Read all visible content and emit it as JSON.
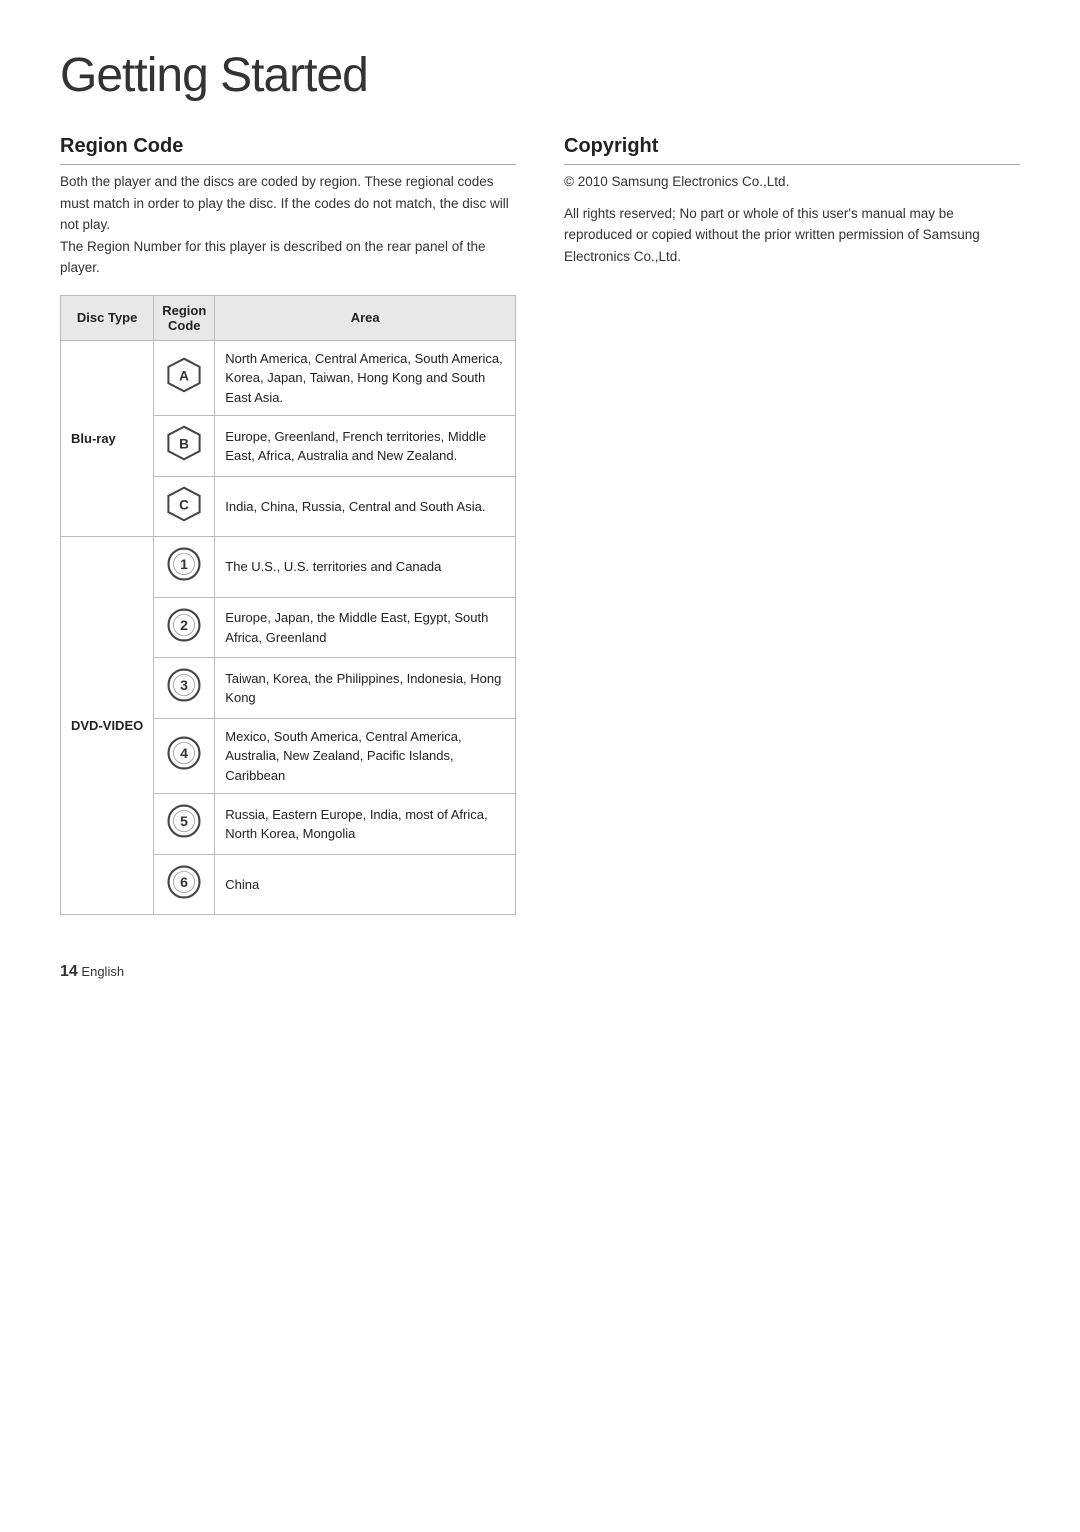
{
  "page": {
    "title": "Getting Started",
    "footer_page_number": "14",
    "footer_language": "English"
  },
  "region_code": {
    "section_title": "Region Code",
    "intro_paragraphs": [
      "Both the player and the discs are coded by region. These regional codes must match in order to play the disc. If the codes do not match, the disc will not play.",
      "The Region Number for this player is described on the rear panel of the player."
    ],
    "table_headers": [
      "Disc Type",
      "Region Code",
      "Area"
    ],
    "rows": [
      {
        "disc_type": "Blu-ray",
        "region_symbol": "A",
        "region_type": "hexagon",
        "area": "North America, Central America, South America, Korea, Japan, Taiwan, Hong Kong and South East Asia.",
        "rowspan": 3,
        "first_in_group": true
      },
      {
        "disc_type": "",
        "region_symbol": "B",
        "region_type": "hexagon",
        "area": "Europe, Greenland, French territories, Middle East, Africa, Australia and New Zealand.",
        "first_in_group": false
      },
      {
        "disc_type": "",
        "region_symbol": "C",
        "region_type": "hexagon",
        "area": "India, China, Russia, Central and South Asia.",
        "first_in_group": false
      },
      {
        "disc_type": "DVD-VIDEO",
        "region_symbol": "1",
        "region_type": "circle",
        "area": "The U.S., U.S. territories and Canada",
        "rowspan": 6,
        "first_in_group": true
      },
      {
        "disc_type": "",
        "region_symbol": "2",
        "region_type": "circle",
        "area": "Europe, Japan, the Middle East, Egypt, South Africa, Greenland",
        "first_in_group": false
      },
      {
        "disc_type": "",
        "region_symbol": "3",
        "region_type": "circle",
        "area": "Taiwan, Korea, the Philippines, Indonesia, Hong Kong",
        "first_in_group": false
      },
      {
        "disc_type": "",
        "region_symbol": "4",
        "region_type": "circle",
        "area": "Mexico, South America, Central America, Australia, New Zealand, Pacific Islands, Caribbean",
        "first_in_group": false
      },
      {
        "disc_type": "",
        "region_symbol": "5",
        "region_type": "circle",
        "area": "Russia, Eastern Europe, India, most of Africa, North Korea, Mongolia",
        "first_in_group": false
      },
      {
        "disc_type": "",
        "region_symbol": "6",
        "region_type": "circle",
        "area": "China",
        "first_in_group": false
      }
    ]
  },
  "copyright": {
    "section_title": "Copyright",
    "lines": [
      "© 2010 Samsung Electronics Co.,Ltd.",
      "All rights reserved; No part or whole of this user's manual may be reproduced or copied without the prior written permission of Samsung Electronics Co.,Ltd."
    ]
  }
}
